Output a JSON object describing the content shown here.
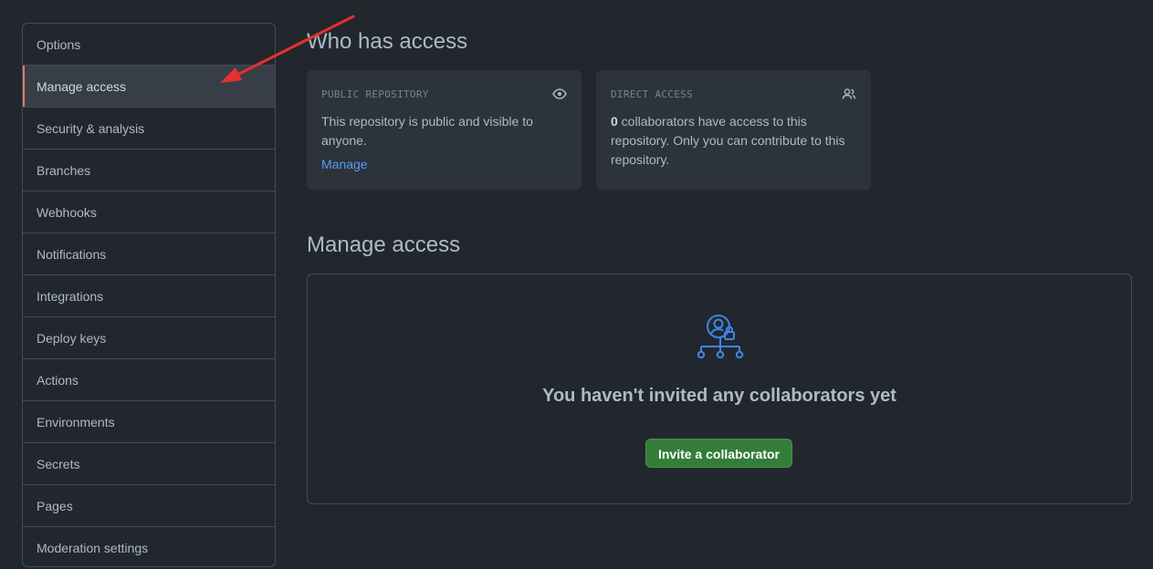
{
  "sidebar": {
    "items": [
      {
        "label": "Options"
      },
      {
        "label": "Manage access"
      },
      {
        "label": "Security & analysis"
      },
      {
        "label": "Branches"
      },
      {
        "label": "Webhooks"
      },
      {
        "label": "Notifications"
      },
      {
        "label": "Integrations"
      },
      {
        "label": "Deploy keys"
      },
      {
        "label": "Actions"
      },
      {
        "label": "Environments"
      },
      {
        "label": "Secrets"
      },
      {
        "label": "Pages"
      },
      {
        "label": "Moderation settings"
      }
    ],
    "active_index": 1
  },
  "who_has_access": {
    "title": "Who has access",
    "public_card": {
      "heading": "PUBLIC REPOSITORY",
      "icon": "eye-icon",
      "text": "This repository is public and visible to anyone.",
      "link": "Manage"
    },
    "direct_card": {
      "heading": "DIRECT ACCESS",
      "icon": "people-icon",
      "count": "0",
      "text": " collaborators have access to this repository. Only you can contribute to this repository."
    }
  },
  "manage_access": {
    "title": "Manage access",
    "icon": "person-lock-network-icon",
    "empty_message": "You haven't invited any collaborators yet",
    "invite_button": "Invite a collaborator"
  },
  "annotation": {
    "type": "red-arrow",
    "color": "#e5312f",
    "points_to": "Manage access"
  },
  "colors": {
    "background": "#22272e",
    "card": "#2d333b",
    "border": "#444c56",
    "link": "#539bf5",
    "accent_active": "#ec775c",
    "button": "#347d39",
    "icon_blue": "#4184e4"
  }
}
